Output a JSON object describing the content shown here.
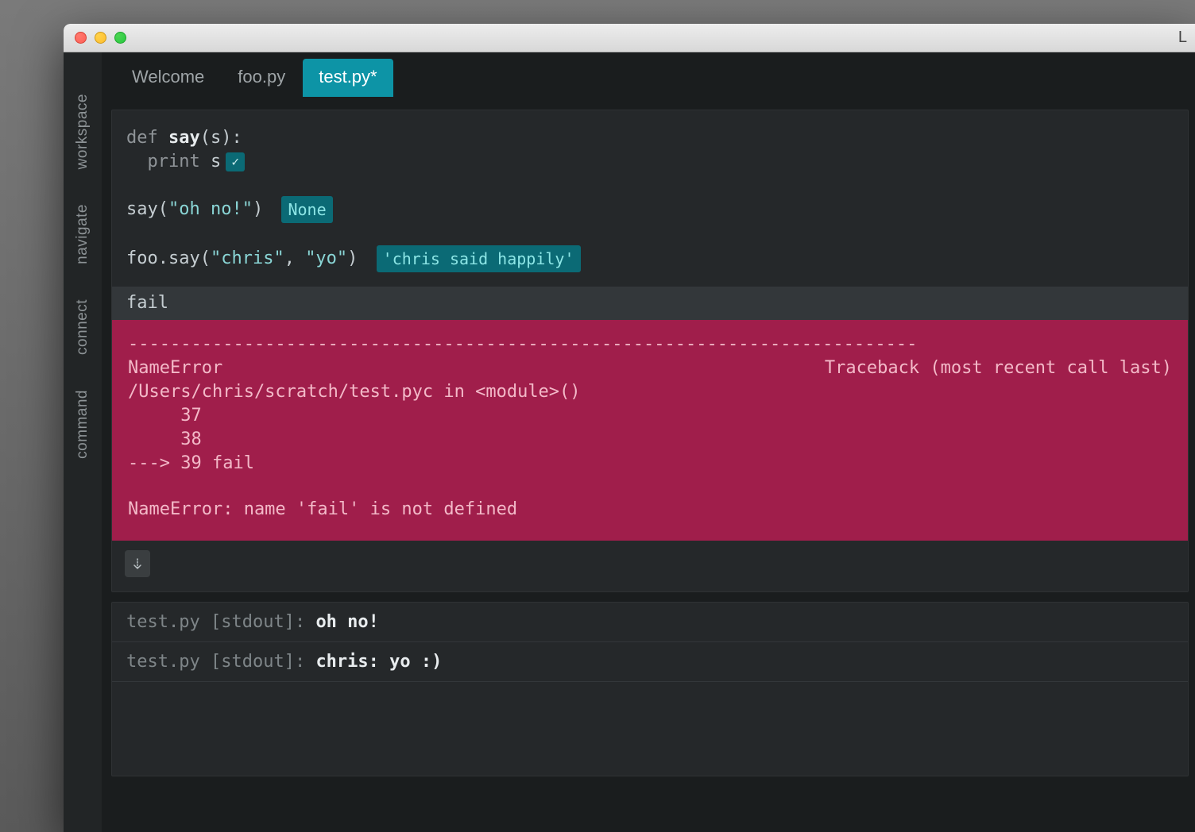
{
  "titlebar": {
    "right_letter": "L"
  },
  "sidebar": {
    "tabs": [
      "workspace",
      "navigate",
      "connect",
      "command"
    ]
  },
  "tabs": [
    {
      "label": "Welcome",
      "active": false
    },
    {
      "label": "foo.py",
      "active": false
    },
    {
      "label": "test.py*",
      "active": true
    }
  ],
  "code": {
    "def_kw": "def ",
    "fn_name": "say",
    "fn_params": "(s):",
    "body_indent": "  ",
    "print_kw": "print ",
    "print_var": "s",
    "call1_pre": "say(",
    "call1_str": "\"oh no!\"",
    "call1_post": ") ",
    "result1": "None",
    "call2_pre": "foo.say(",
    "call2_str1": "\"chris\"",
    "call2_sep": ", ",
    "call2_str2": "\"yo\"",
    "call2_post": ") ",
    "result2": "'chris said happily'",
    "fail_line": "fail"
  },
  "error": {
    "dashes": "---------------------------------------------------------------------------",
    "err_name_left": "NameError",
    "err_name_right": "Traceback (most recent call last)",
    "path": "/Users/chris/scratch/test.pyc in <module>()",
    "l37": "     37 ",
    "l38": "     38 ",
    "l39": "---> 39 fail",
    "final": "NameError: name 'fail' is not defined"
  },
  "console": {
    "line1_file": "test.py ",
    "line1_tag": "[stdout]",
    "line1_sep": ": ",
    "line1_out": "oh no!",
    "line2_file": "test.py ",
    "line2_tag": "[stdout]",
    "line2_sep": ": ",
    "line2_out": "chris: yo :)"
  }
}
